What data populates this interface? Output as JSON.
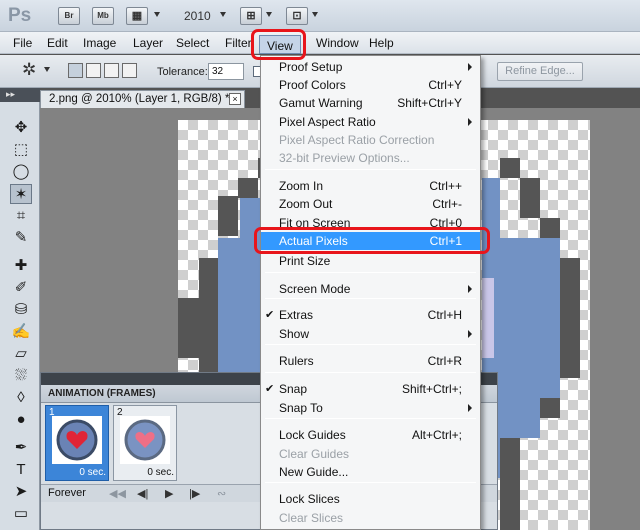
{
  "titlebar": {
    "app_logo": "Ps",
    "bridge_label": "Br",
    "minibridge_label": "Mb",
    "zoom_value": "2010"
  },
  "menubar": {
    "items": [
      "File",
      "Edit",
      "Image",
      "Layer",
      "Select",
      "Filter",
      "View",
      "Window",
      "Help"
    ]
  },
  "options": {
    "tolerance_label": "Tolerance:",
    "tolerance_value": "32",
    "refine_edge": "Refine Edge..."
  },
  "document": {
    "tab_title": "2.png @ 2010% (Layer 1, RGB/8) *",
    "close": "×"
  },
  "tools": {
    "header_chevron": "▸▸",
    "icons": [
      "move-icon",
      "marquee-icon",
      "lasso-icon",
      "magic-wand-icon",
      "crop-icon",
      "eyedropper-icon",
      "healing-brush-icon",
      "brush-icon",
      "clone-stamp-icon",
      "history-brush-icon",
      "eraser-icon",
      "paint-bucket-icon",
      "blur-icon",
      "dodge-icon",
      "pen-icon",
      "type-icon",
      "path-selection-icon",
      "rectangle-icon"
    ],
    "glyphs": [
      "✥",
      "⬚",
      "◯",
      "✶",
      "⌗",
      "✎",
      "✚",
      "✐",
      "⛁",
      "✍",
      "▱",
      "⛆",
      "◊",
      "●",
      "✒",
      "T",
      "➤",
      "▭"
    ]
  },
  "animation": {
    "title": "ANIMATION (FRAMES)",
    "frames": [
      {
        "num": "1",
        "delay": "0 sec."
      },
      {
        "num": "2",
        "delay": "0 sec."
      }
    ],
    "loop": "Forever",
    "controls": [
      "◀◀",
      "◀|",
      "▶",
      "|▶",
      "∾"
    ]
  },
  "view_menu": {
    "items": [
      {
        "label": "Proof Setup",
        "shortcut": "",
        "submenu": true
      },
      {
        "label": "Proof Colors",
        "shortcut": "Ctrl+Y"
      },
      {
        "label": "Gamut Warning",
        "shortcut": "Shift+Ctrl+Y"
      },
      {
        "label": "Pixel Aspect Ratio",
        "shortcut": "",
        "submenu": true
      },
      {
        "label": "Pixel Aspect Ratio Correction",
        "shortcut": "",
        "disabled": true
      },
      {
        "label": "32-bit Preview Options...",
        "shortcut": "",
        "disabled": true
      },
      {
        "label": "Zoom In",
        "shortcut": "Ctrl++"
      },
      {
        "label": "Zoom Out",
        "shortcut": "Ctrl+-"
      },
      {
        "label": "Fit on Screen",
        "shortcut": "Ctrl+0"
      },
      {
        "label": "Actual Pixels",
        "shortcut": "Ctrl+1",
        "highlighted": true
      },
      {
        "label": "Print Size",
        "shortcut": ""
      },
      {
        "label": "Screen Mode",
        "shortcut": "",
        "submenu": true
      },
      {
        "label": "Extras",
        "shortcut": "Ctrl+H",
        "checked": true
      },
      {
        "label": "Show",
        "shortcut": "",
        "submenu": true
      },
      {
        "label": "Rulers",
        "shortcut": "Ctrl+R"
      },
      {
        "label": "Snap",
        "shortcut": "Shift+Ctrl+;",
        "checked": true
      },
      {
        "label": "Snap To",
        "shortcut": "",
        "submenu": true
      },
      {
        "label": "Lock Guides",
        "shortcut": "Alt+Ctrl+;"
      },
      {
        "label": "Clear Guides",
        "shortcut": "",
        "disabled": true
      },
      {
        "label": "New Guide...",
        "shortcut": ""
      },
      {
        "label": "Lock Slices",
        "shortcut": ""
      },
      {
        "label": "Clear Slices",
        "shortcut": "",
        "disabled": true
      }
    ],
    "check_glyph": "✔"
  },
  "colors": {
    "highlight": "#3399ff",
    "annotation_red": "#e8151b",
    "pixel_blue": "#7292c4",
    "pixel_dark": "#555555"
  }
}
